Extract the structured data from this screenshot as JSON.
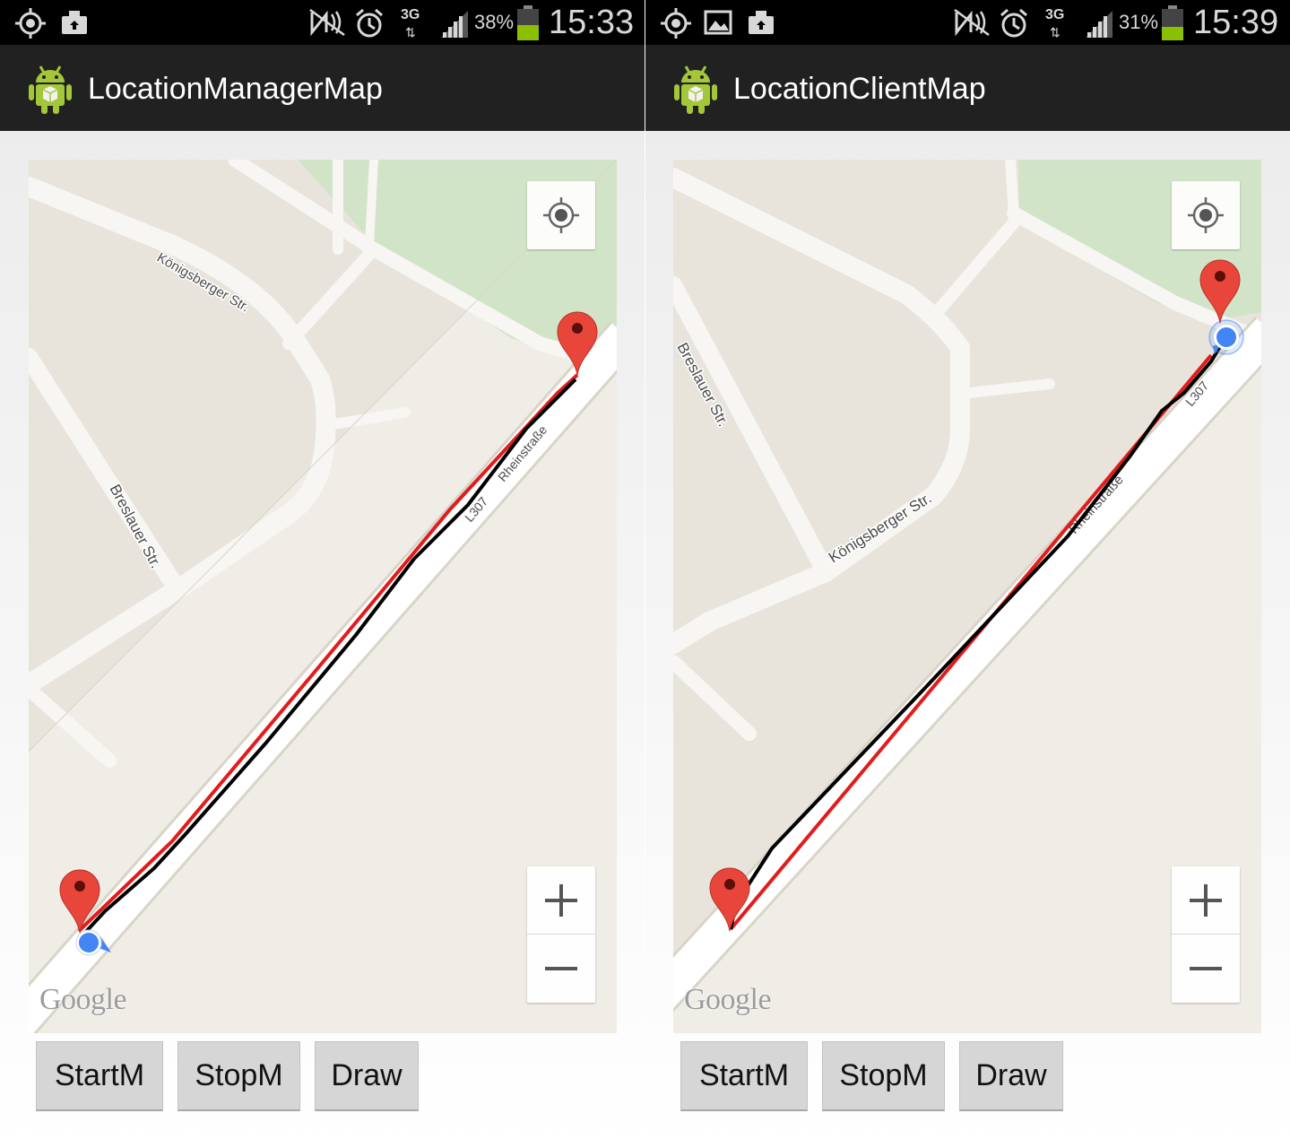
{
  "left": {
    "status": {
      "battery_pct": "38%",
      "time": "15:33",
      "network": "3G"
    },
    "app_title": "LocationManagerMap",
    "streets": {
      "koenigsberger": "Königsberger Str.",
      "breslauer": "Breslauer Str.",
      "rheinstrasse": "Rheinstraße",
      "l307": "L307"
    },
    "map_attribution": "Google",
    "zoom_in": "+",
    "zoom_out": "−",
    "buttons": {
      "start": "StartM",
      "stop": "StopM",
      "draw": "Draw"
    }
  },
  "right": {
    "status": {
      "battery_pct": "31%",
      "time": "15:39",
      "network": "3G"
    },
    "app_title": "LocationClientMap",
    "streets": {
      "koenigsberger": "Königsberger Str.",
      "breslauer": "Breslauer Str.",
      "rheinstrasse": "Rheinstraße",
      "l307": "L307"
    },
    "map_attribution": "Google",
    "zoom_in": "+",
    "zoom_out": "−",
    "buttons": {
      "start": "StartM",
      "stop": "StopM",
      "draw": "Draw"
    }
  },
  "icons": {
    "status_left": [
      "gps-icon",
      "screenshot-icon"
    ],
    "status_right": [
      "gps-icon",
      "image-icon",
      "screenshot-icon"
    ],
    "status_common": [
      "nfc-icon",
      "alarm-icon",
      "signal-icon",
      "battery-icon"
    ],
    "app": "android-app-icon",
    "locate": "my-location-icon",
    "marker": "map-pin-icon",
    "location_dot": "location-dot-icon"
  },
  "colors": {
    "statusbar": "#000000",
    "actionbar": "#212121",
    "map_land": "#e8e4dc",
    "map_park": "#d2e4c8",
    "road": "#ffffff",
    "track_recorded": "#e31b1b",
    "track_drawn": "#000000",
    "marker": "#e8463b",
    "location_dot": "#4285f4",
    "battery_fill": "#8bc000",
    "button": "#d6d6d6"
  }
}
